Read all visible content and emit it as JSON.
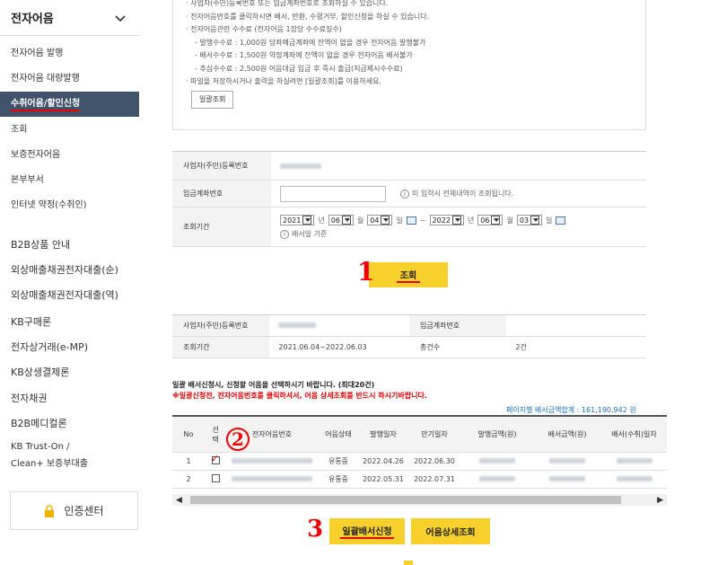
{
  "sidebar": {
    "title": "전자어음",
    "sub_items": [
      "전자어음 발행",
      "전자어음 대량발행",
      "수취어음/할인신청",
      "조회",
      "보증전자어음",
      "본부부서",
      "인터넷 약정(수취인)"
    ],
    "main_items": [
      "B2B상품 안내",
      "외상매출채권전자대출(순)",
      "외상매출채권전자대출(역)",
      "KB구매론",
      "전자상거래(e-MP)",
      "KB상생결제론",
      "전자채권",
      "B2B메디컬론",
      "KB Trust-On /",
      "Clean+ 보증부대출"
    ],
    "cert_label": "인증센터"
  },
  "notice": {
    "lines": [
      "사업자(주민)등록번호 또는 입금계좌번호로 조회하실 수 있습니다.",
      "전자어음번호를 클릭하시면 배서, 반환, 수령거부, 할인신청을 하실 수 있습니다.",
      "전자어음관련 수수료 (전자어음 1장당 수수료징수)"
    ],
    "fee_lines": [
      "발행수수료 : 1,000원 당좌예금계좌에 잔액이 없을 경우 전자어음 발행불가",
      "배서수수료 : 1,500원 약정계좌에 잔액이 없을 경우 전자어음 배서불가",
      "추심수수료 : 2,500원 어음대금 입금 후 즉시 출금(지급제시수수료)"
    ],
    "save_line": "파일을 저장하시거나 출력을 하실려면 [일괄조회]를 이용하세요.",
    "batch_view_button": "일괄조회"
  },
  "form": {
    "bizno_label": "사업자(주민)등록번호",
    "account_label": "입금계좌번호",
    "account_value": "",
    "account_hint": "미 입력시 전체내역이 조회됩니다.",
    "period_label": "조회기간",
    "from": {
      "year": "2021",
      "month": "06",
      "day": "04"
    },
    "to": {
      "year": "2022",
      "month": "06",
      "day": "03"
    },
    "year_unit": "년",
    "month_unit": "월",
    "day_unit": "일",
    "tilde": "~",
    "period_hint": "배서일 기준",
    "info_icon": "i"
  },
  "search_button": "조회",
  "summary": {
    "bizno_label": "사업자(주민)등록번호",
    "account_label": "입금계좌번호",
    "account_value": "",
    "period_label": "조회기간",
    "period_value": "2021.06.04~2022.06.03",
    "count_label": "총건수",
    "count_value": "2건"
  },
  "messages": {
    "msg1": "일괄 배서신청시, 신청할 어음을 선택하시기 바랍니다. (최대20건)",
    "msg2": "※일괄신청전, 전자어음번호를 클릭하셔서, 어음 상세조회를 반드시 하시기바랍니다.",
    "total": "페이지별 배서금액합계 : 161,190,942 원"
  },
  "table": {
    "headers": [
      "No",
      "선택",
      "전자어음번호",
      "어음상태",
      "발행일자",
      "만기일자",
      "발행금액(원)",
      "배서금액(원)",
      "배서(수취)일자"
    ],
    "rows": [
      {
        "no": "1",
        "checked": true,
        "status": "유통중",
        "issue": "2022.04.26",
        "due": "2022.06.30"
      },
      {
        "no": "2",
        "checked": false,
        "status": "유통중",
        "issue": "2022.05.31",
        "due": "2022.07.31"
      }
    ]
  },
  "buttons": {
    "batch_endorse": "일괄배서신청",
    "detail_view": "어음상세조회"
  },
  "annotations": {
    "a1": "1",
    "a2": "2",
    "a3": "3"
  },
  "colors": {
    "accent": "#f7d02c",
    "active_bg": "#41536b",
    "alert": "#dd0000",
    "link": "#1a73c0"
  }
}
